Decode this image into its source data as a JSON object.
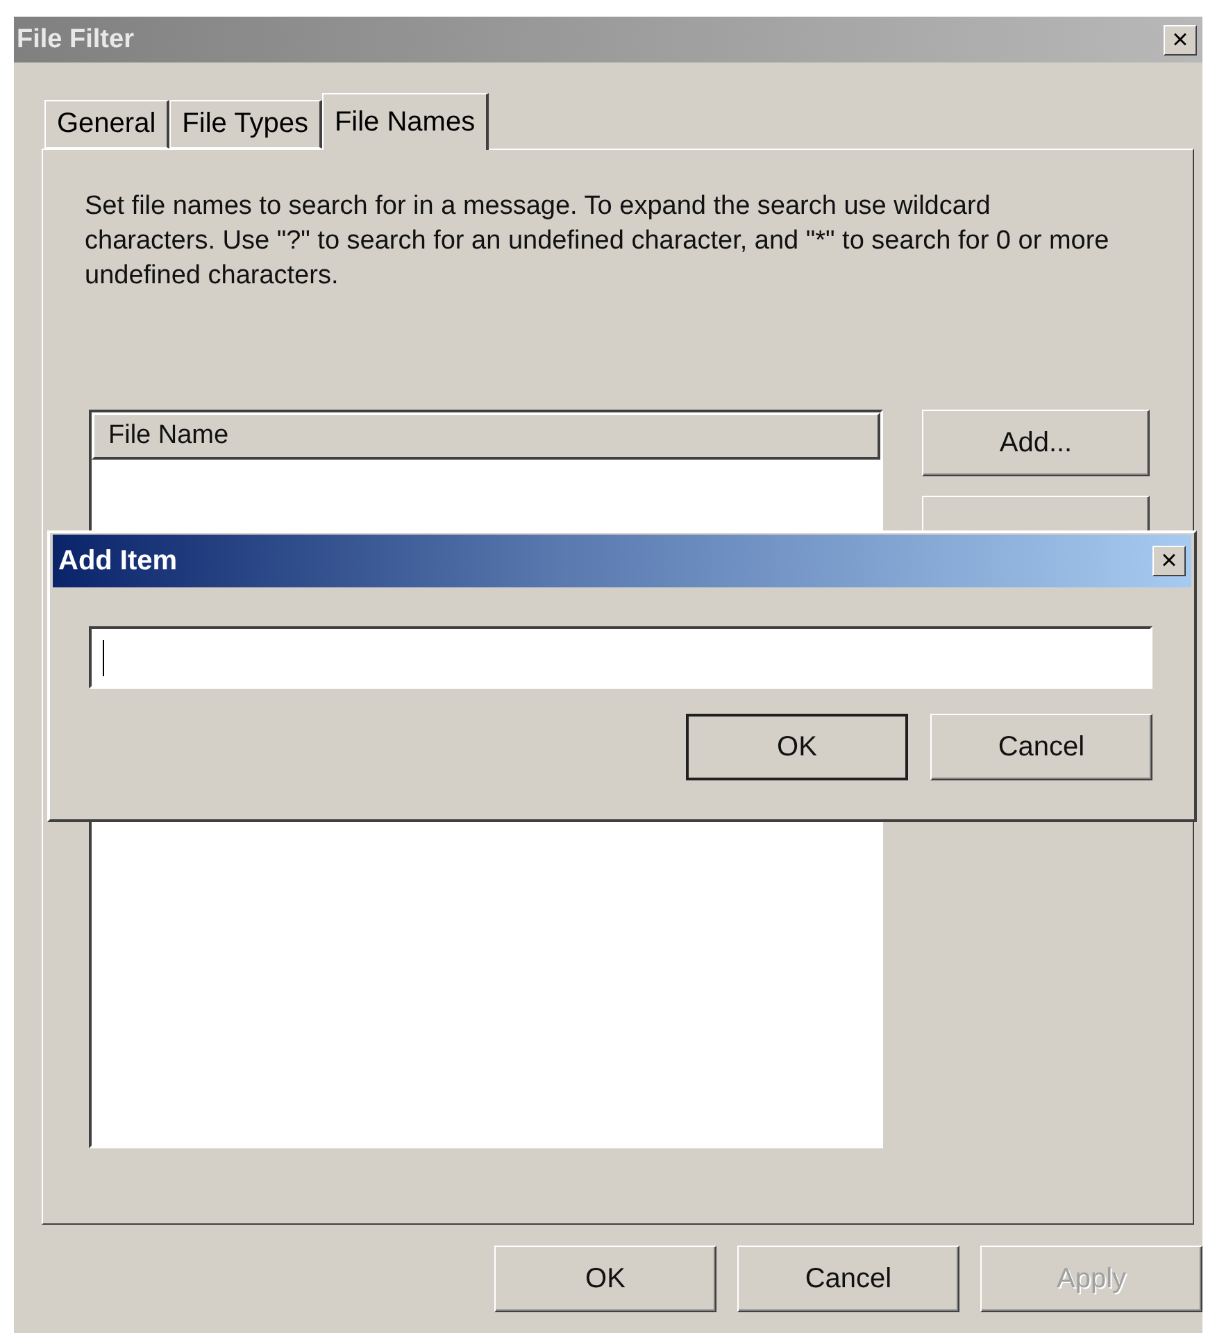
{
  "window": {
    "title": "File Filter",
    "close": "×"
  },
  "tabs": [
    {
      "label": "General",
      "selected": false
    },
    {
      "label": "File Types",
      "selected": false
    },
    {
      "label": "File Names",
      "selected": true
    }
  ],
  "description": "Set file names to search for in a message. To expand the search use wildcard characters. Use \"?\" to search for an undefined character, and \"*\" to search for 0 or more undefined characters.",
  "file_list": {
    "columns": [
      "File Name"
    ]
  },
  "side_buttons": [
    {
      "label": "Add..."
    }
  ],
  "dialog": {
    "title": "Add Item",
    "close": "×",
    "buttons": [
      {
        "label": "OK",
        "default": true
      },
      {
        "label": "Cancel",
        "default": false
      }
    ]
  },
  "footer_buttons": [
    {
      "label": "OK",
      "disabled": false
    },
    {
      "label": "Cancel",
      "disabled": false
    },
    {
      "label": "Apply",
      "disabled": true
    }
  ]
}
